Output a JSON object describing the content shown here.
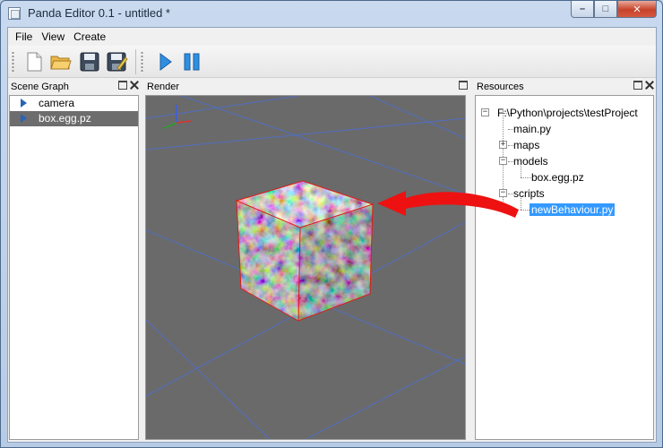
{
  "window": {
    "title": "Panda Editor 0.1 - untitled *",
    "controls": {
      "minimize": "–",
      "maximize": "□",
      "close": "✕"
    }
  },
  "menu": {
    "items": [
      {
        "label": "File"
      },
      {
        "label": "View"
      },
      {
        "label": "Create"
      }
    ]
  },
  "toolbar": {
    "buttons": [
      {
        "name": "new-file-icon"
      },
      {
        "name": "open-folder-icon"
      },
      {
        "name": "save-icon"
      },
      {
        "name": "save-as-icon"
      },
      {
        "name": "play-icon"
      },
      {
        "name": "pause-icon"
      }
    ]
  },
  "scene_graph": {
    "title": "Scene Graph",
    "items": [
      {
        "label": "camera",
        "selected": false
      },
      {
        "label": "box.egg.pz",
        "selected": true
      }
    ]
  },
  "render": {
    "title": "Render"
  },
  "resources": {
    "title": "Resources",
    "root": "F:\\Python\\projects\\testProject",
    "items": [
      {
        "label": "main.py"
      },
      {
        "label": "maps"
      },
      {
        "label": "models"
      },
      {
        "label": "box.egg.pz"
      },
      {
        "label": "scripts"
      },
      {
        "label": "newBehaviour.py",
        "selected": true
      }
    ]
  },
  "colors": {
    "selection": "#3399ff",
    "arrow": "#ee1111",
    "render_bg": "#6a6a6a",
    "grid": "#4d6fd0"
  }
}
